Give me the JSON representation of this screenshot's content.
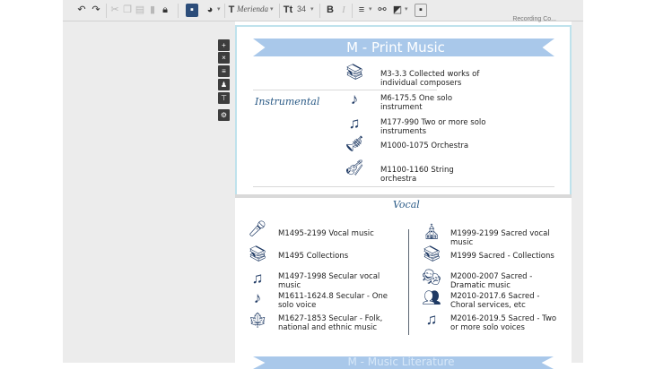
{
  "toolbar": {
    "font_name": "Merienda",
    "font_size": "34"
  },
  "top_label": "Recording Co...",
  "slide1": {
    "title": "M - Print Music",
    "category": "Instrumental",
    "items": [
      {
        "icon": "books-icon",
        "line1": "M3-3.3  Collected works of",
        "line2": "individual composers"
      },
      {
        "icon": "music-note-icon",
        "line1": "M6-175.5  One solo",
        "line2": "instrument"
      },
      {
        "icon": "double-note-icon",
        "line1": "M177-990  Two or more solo",
        "line2": "instruments"
      },
      {
        "icon": "trumpet-icon",
        "line1": "M1000-1075  Orchestra",
        "line2": ""
      },
      {
        "icon": "violin-icon",
        "line1": "M1100-1160  String",
        "line2": "orchestra"
      }
    ]
  },
  "slide2": {
    "category": "Vocal",
    "left_items": [
      {
        "icon": "microphone-icon",
        "line1": "M1495-2199  Vocal music",
        "line2": ""
      },
      {
        "icon": "books-icon",
        "line1": "M1495  Collections",
        "line2": ""
      },
      {
        "icon": "music-notes-icon",
        "line1": "M1497-1998  Secular vocal",
        "line2": "music"
      },
      {
        "icon": "music-note-icon",
        "line1": "M1611-1624.8  Secular - One",
        "line2": "solo voice"
      },
      {
        "icon": "maple-leaf-icon",
        "line1": "M1627-1853  Secular - Folk,",
        "line2": "national and ethnic music"
      }
    ],
    "right_items": [
      {
        "icon": "church-icon",
        "line1": "M1999-2199  Sacred vocal",
        "line2": "music"
      },
      {
        "icon": "church-books-icon",
        "line1": "M1999  Sacred - Collections",
        "line2": ""
      },
      {
        "icon": "theater-masks-icon",
        "line1": "M2000-2007  Sacred -",
        "line2": "Dramatic music"
      },
      {
        "icon": "choir-icon",
        "line1": "M2010-2017.6  Sacred -",
        "line2": "Choral services, etc"
      },
      {
        "icon": "double-note-icon",
        "line1": "M2016-2019.5  Sacred - Two",
        "line2": "or more solo voices"
      }
    ]
  },
  "slide3_peek_title": "M - Music Literature"
}
